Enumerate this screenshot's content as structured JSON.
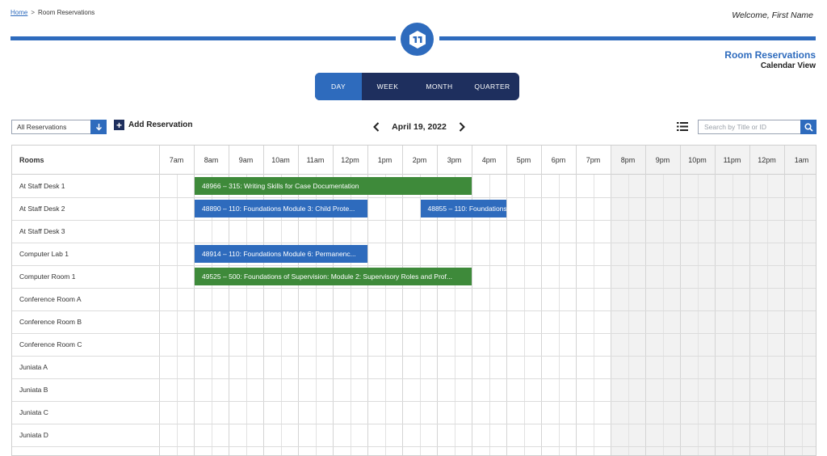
{
  "breadcrumb": {
    "home": "Home",
    "separator": ">",
    "current": "Room Reservations"
  },
  "welcome": "Welcome, First Name",
  "page": {
    "title": "Room Reservations",
    "subtitle": "Calendar View"
  },
  "colors": {
    "primary": "#2e6bbd",
    "navy": "#1e2f5e",
    "event_green": "#3e8a3a",
    "event_blue": "#2e6bbd",
    "offhours": "#f2f2f2"
  },
  "view_tabs": [
    {
      "label": "DAY",
      "active": true
    },
    {
      "label": "WEEK",
      "active": false
    },
    {
      "label": "MONTH",
      "active": false
    },
    {
      "label": "QUARTER",
      "active": false
    }
  ],
  "toolbar": {
    "filter_value": "All Reservations",
    "add_label": "Add Reservation",
    "date": "April 19, 2022",
    "search_placeholder": "Search by Title or ID"
  },
  "calendar": {
    "rooms_header": "Rooms",
    "hours": [
      "7am",
      "8am",
      "9am",
      "10am",
      "11am",
      "12pm",
      "1pm",
      "2pm",
      "3pm",
      "4pm",
      "5pm",
      "6pm",
      "7pm",
      "8pm",
      "9pm",
      "10pm",
      "11pm",
      "12pm",
      "1am"
    ],
    "offhours_start_index": 13,
    "rooms": [
      "At Staff Desk 1",
      "At Staff Desk 2",
      "At Staff Desk 3",
      "Computer Lab 1",
      "Computer Room 1",
      "Conference Room A",
      "Conference Room B",
      "Conference Room C",
      "Juniata A",
      "Juniata B",
      "Juniata C",
      "Juniata D"
    ],
    "events": [
      {
        "room": 0,
        "start": 1,
        "end": 9,
        "color": "green",
        "label": "48966 – 315: Writing Skills for Case Documentation"
      },
      {
        "room": 1,
        "start": 1,
        "end": 6,
        "color": "blue",
        "label": "48890 – 110: Foundations Module 3: Child Prote..."
      },
      {
        "room": 1,
        "start": 7.5,
        "end": 10,
        "color": "blue",
        "label": "48855 – 110: Foundations ..."
      },
      {
        "room": 3,
        "start": 1,
        "end": 6,
        "color": "blue",
        "label": "48914 – 110: Foundations Module 6: Permanenc..."
      },
      {
        "room": 4,
        "start": 1,
        "end": 9,
        "color": "green",
        "label": "49525 – 500: Foundations of Supervision: Module 2: Supervisory Roles and Prof..."
      }
    ]
  }
}
